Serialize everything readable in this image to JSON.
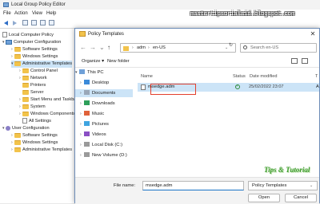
{
  "gpe": {
    "title": "Local Group Policy Editor",
    "menu": [
      "File",
      "Action",
      "View",
      "Help"
    ],
    "tree": [
      {
        "label": "Local Computer Policy",
        "icon": "policy-icon"
      },
      {
        "label": "Computer Configuration",
        "icon": "computer-icon"
      },
      {
        "label": "Software Settings",
        "icon": "folder-icon"
      },
      {
        "label": "Windows Settings",
        "icon": "folder-icon"
      },
      {
        "label": "Administrative Templates",
        "icon": "folder-icon"
      },
      {
        "label": "Control Panel",
        "icon": "folder-icon"
      },
      {
        "label": "Network",
        "icon": "folder-icon"
      },
      {
        "label": "Printers",
        "icon": "folder-icon"
      },
      {
        "label": "Server",
        "icon": "folder-icon"
      },
      {
        "label": "Start Menu and Taskba",
        "icon": "folder-icon"
      },
      {
        "label": "System",
        "icon": "folder-icon"
      },
      {
        "label": "Windows Components",
        "icon": "folder-icon"
      },
      {
        "label": "All Settings",
        "icon": "settings-icon"
      },
      {
        "label": "User Configuration",
        "icon": "user-icon"
      },
      {
        "label": "Software Settings",
        "icon": "folder-icon"
      },
      {
        "label": "Windows Settings",
        "icon": "folder-icon"
      },
      {
        "label": "Administrative Templates",
        "icon": "folder-icon"
      }
    ]
  },
  "watermark_url": "mastertipsorialsid.blogspot.com",
  "dialog": {
    "title": "Policy Templates",
    "address": [
      "adm",
      "en-US"
    ],
    "search_placeholder": "Search en-US",
    "organize_label": "Organize ▾",
    "new_folder_label": "New folder",
    "nav_pane": [
      {
        "label": "This PC",
        "icon": "pc-icon",
        "expander": "▾"
      },
      {
        "label": "Desktop",
        "icon": "desktop-icon",
        "expander": "›"
      },
      {
        "label": "Documents",
        "icon": "documents-icon",
        "expander": "›"
      },
      {
        "label": "Downloads",
        "icon": "downloads-icon",
        "expander": "›"
      },
      {
        "label": "Music",
        "icon": "music-icon",
        "expander": "›"
      },
      {
        "label": "Pictures",
        "icon": "pictures-icon",
        "expander": "›"
      },
      {
        "label": "Videos",
        "icon": "videos-icon",
        "expander": "›"
      },
      {
        "label": "Local Disk (C:)",
        "icon": "drive-icon",
        "expander": "›"
      },
      {
        "label": "New Volume (D:)",
        "icon": "drive-icon",
        "expander": "›"
      }
    ],
    "columns": {
      "name": "Name",
      "status": "Status",
      "date": "Date modified",
      "type": "T"
    },
    "files": [
      {
        "name": "msedge.adm",
        "status_icon": "synced-check-icon",
        "date": "25/02/2022 23:07",
        "type": "A"
      }
    ],
    "file_name_label": "File name:",
    "file_name_value": "msedge.adm",
    "file_type": "Policy Templates",
    "open_label": "Open",
    "cancel_label": "Cancel",
    "watermark": "Tips & Tutorial"
  },
  "colors": {
    "selection": "#cce4f7",
    "highlight_box": "#e3402c",
    "watermark_green": "#3a9a2a"
  }
}
